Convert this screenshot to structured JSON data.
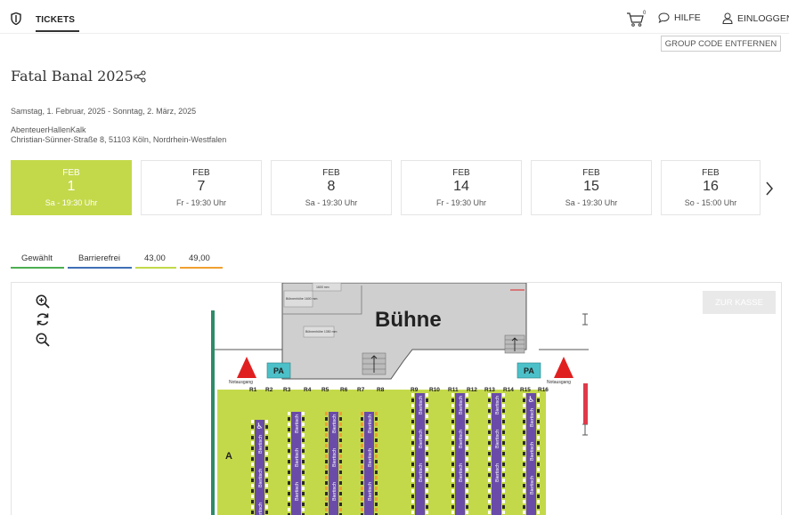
{
  "header": {
    "nav_tickets": "TICKETS",
    "cart_count": "0",
    "help_label": "HILFE",
    "login_label": "EINLOGGEN",
    "group_code_button": "GROUP CODE ENTFERNEN",
    "icons": [
      "shield-icon",
      "cart-icon",
      "chat-bubble-icon",
      "user-icon"
    ]
  },
  "event": {
    "title": "Fatal Banal 2025",
    "date_range": "Samstag, 1. Februar, 2025 - Sonntag, 2. März, 2025",
    "venue_name": "AbenteuerHallenKalk",
    "venue_address": "Christian-Sünner-Straße 8, 51103 Köln, Nordrhein-Westfalen"
  },
  "dates": [
    {
      "month": "FEB",
      "day": "1",
      "time": "Sa - 19:30 Uhr",
      "selected": true
    },
    {
      "month": "FEB",
      "day": "7",
      "time": "Fr - 19:30 Uhr",
      "selected": false
    },
    {
      "month": "FEB",
      "day": "8",
      "time": "Sa - 19:30 Uhr",
      "selected": false
    },
    {
      "month": "FEB",
      "day": "14",
      "time": "Fr - 19:30 Uhr",
      "selected": false
    },
    {
      "month": "FEB",
      "day": "15",
      "time": "Sa - 19:30 Uhr",
      "selected": false
    },
    {
      "month": "FEB",
      "day": "16",
      "time": "So - 15:00 Uhr",
      "selected": false
    }
  ],
  "legend": [
    {
      "label": "Gewählt",
      "color": "#4caf50"
    },
    {
      "label": "Barrierefrei",
      "color": "#3f6fb5"
    },
    {
      "label": "43,00",
      "color": "#c4d94a"
    },
    {
      "label": "49,00",
      "color": "#f0a030"
    }
  ],
  "map": {
    "checkout_button": "ZUR KASSE",
    "stage_label": "Bühne",
    "pa_label": "PA",
    "emergency_exit_label": "Notausgang",
    "block_label": "A",
    "table_label": "Biertisch",
    "stage_sign_1": "Bühnenhöhe 1600 mm",
    "stage_sign_2": "Bühnenhöhe 1350 mm",
    "stage_sign_3": "1600 mm",
    "row_labels": [
      "R1",
      "R2",
      "R3",
      "R4",
      "R5",
      "R6",
      "R7",
      "R8",
      "R9",
      "R10",
      "R11",
      "R12",
      "R13",
      "R14",
      "R15",
      "R16"
    ],
    "colors": {
      "floor": "#c4d94a",
      "table": "#6a4ca8",
      "stage": "#cfcfcf",
      "pa": "#4cc0c8",
      "exit": "#e02020",
      "wall": "#2e8b6a"
    }
  }
}
